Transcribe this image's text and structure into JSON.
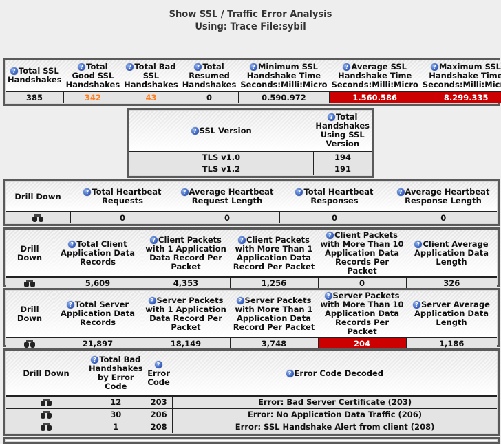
{
  "page": {
    "title_line1": "Show SSL / Traffic Error Analysis",
    "title_line2": "Using: Trace File:sybil"
  },
  "colors": {
    "alert_red": "#cc0000",
    "warn_orange": "#ff7f1e",
    "help_icon_blue": "#3a62c0"
  },
  "handshake_summary": {
    "headers": [
      "Total SSL Handshakes",
      "Total Good SSL Handshakes",
      "Total Bad SSL Handshakes",
      "Total Resumed Handshakes",
      "Minimum SSL Handshake Time Seconds:Milli:Micro",
      "Average SSL Handshake Time Seconds:Milli:Micro",
      "Maximum SSL Handshake Time Seconds:Milli:Micro"
    ],
    "values": [
      "385",
      "342",
      "43",
      "0",
      "0.590.972",
      "1.560.586",
      "8.299.335"
    ]
  },
  "ssl_versions": {
    "headers": [
      "SSL Version",
      "Total Handshakes Using SSL Version"
    ],
    "rows": [
      {
        "version": "TLS v1.0",
        "count": "194"
      },
      {
        "version": "TLS v1.2",
        "count": "191"
      }
    ]
  },
  "heartbeat": {
    "drill_down_label": "Drill Down",
    "headers": [
      "Total Heartbeat Requests",
      "Average Heartbeat Request Length",
      "Total Heartbeat Responses",
      "Average Heartbeat Response Length"
    ],
    "values": [
      "0",
      "0",
      "0",
      "0"
    ]
  },
  "client_app_data": {
    "drill_down_label": "Drill Down",
    "headers": [
      "Total Client Application Data Records",
      "Client Packets with 1 Application Data Record Per Packet",
      "Client Packets with More Than 1 Application Data Record Per Packet",
      "Client Packets with More Than 10 Application Data Records Per Packet",
      "Client Average Application Data Length"
    ],
    "values": [
      "5,609",
      "4,353",
      "1,256",
      "0",
      "326"
    ]
  },
  "server_app_data": {
    "drill_down_label": "Drill Down",
    "headers": [
      "Total Server Application Data Records",
      "Server Packets with 1 Application Data Record Per Packet",
      "Server Packets with More Than 1 Application Data Record Per Packet",
      "Server Packets with More Than 10 Application Data Records Per Packet",
      "Server Average Application Data Length"
    ],
    "values": [
      "21,897",
      "18,149",
      "3,748",
      "204",
      "1,186"
    ]
  },
  "error_codes": {
    "drill_down_label": "Drill Down",
    "headers": [
      "Total Bad Handshakes by Error Code",
      "Error Code",
      "Error Code Decoded"
    ],
    "rows": [
      {
        "count": "12",
        "code": "203",
        "decoded": "Error: Bad Server Certificate (203)"
      },
      {
        "count": "30",
        "code": "206",
        "decoded": "Error: No Application Data Traffic (206)"
      },
      {
        "count": "1",
        "code": "208",
        "decoded": "Error: SSL Handshake Alert from client (208)"
      }
    ]
  },
  "icons": {
    "help": "question-circle",
    "drill_down": "binoculars"
  }
}
